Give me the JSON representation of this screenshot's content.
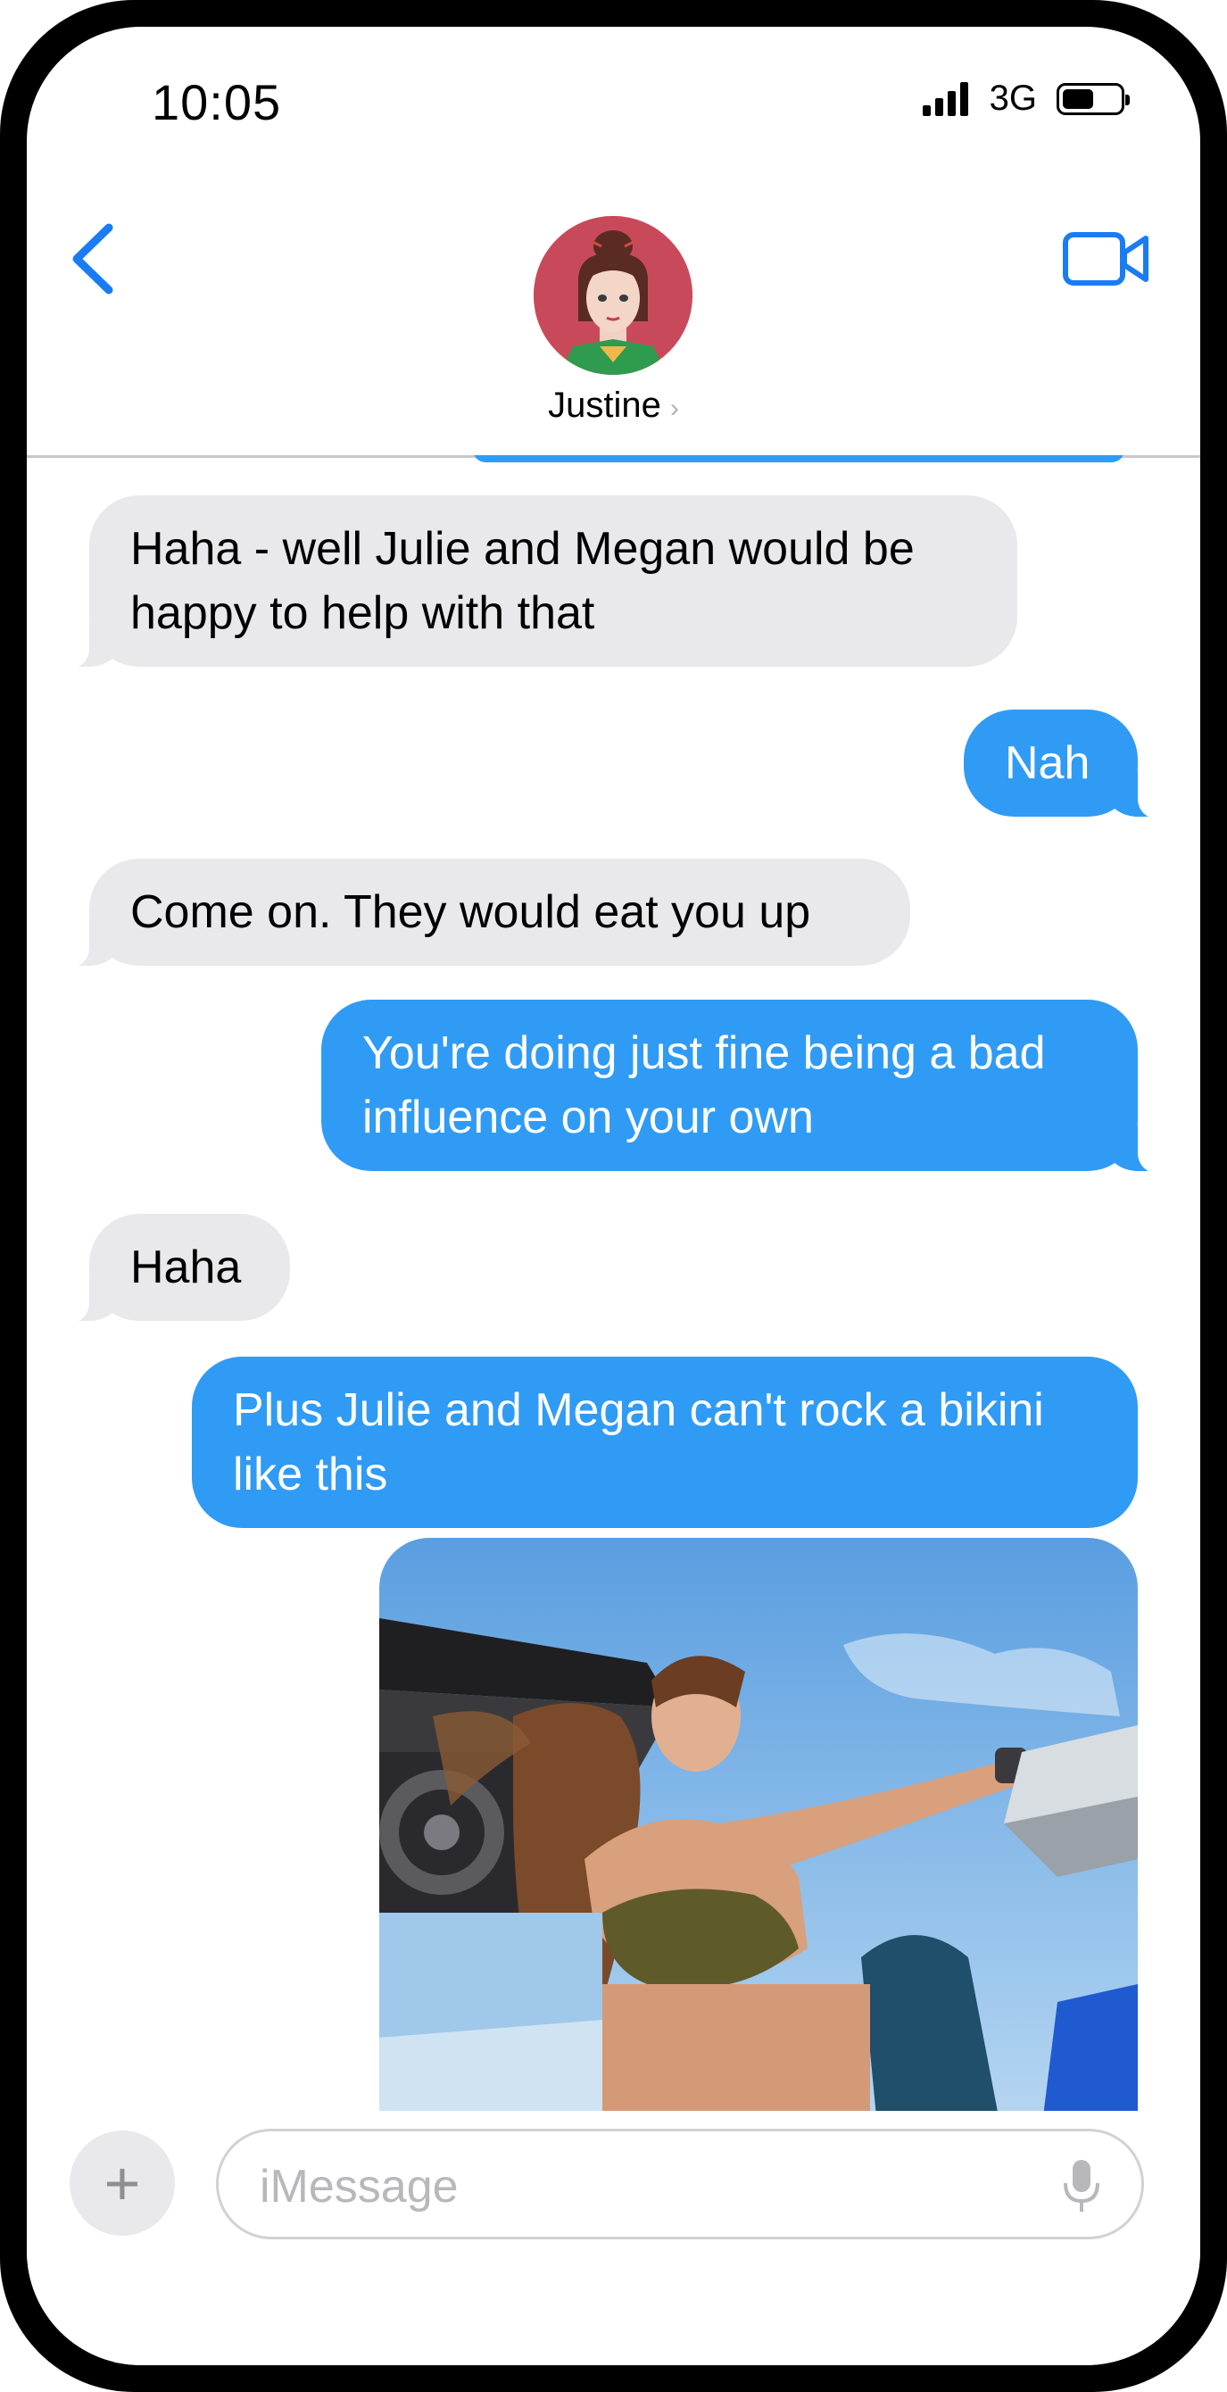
{
  "status_bar": {
    "time": "10:05",
    "network": "3G"
  },
  "header": {
    "contact_name": "Justine",
    "chevron": "›"
  },
  "messages": [
    {
      "direction": "incoming",
      "text": "Haha - well Julie and Megan would be happy to help with that"
    },
    {
      "direction": "outgoing",
      "text": "Nah"
    },
    {
      "direction": "incoming",
      "text": "Come on.  They would eat you up"
    },
    {
      "direction": "outgoing",
      "text": "You're doing just fine being a bad influence on your own"
    },
    {
      "direction": "incoming",
      "text": "Haha"
    },
    {
      "direction": "outgoing",
      "text": "Plus Julie and Megan can't rock a bikini like this"
    }
  ],
  "composer": {
    "placeholder": "iMessage",
    "plus_symbol": "+"
  },
  "colors": {
    "outgoing_bubble": "#309bf5",
    "incoming_bubble": "#e9e9eb",
    "accent": "#1a7cf5"
  }
}
